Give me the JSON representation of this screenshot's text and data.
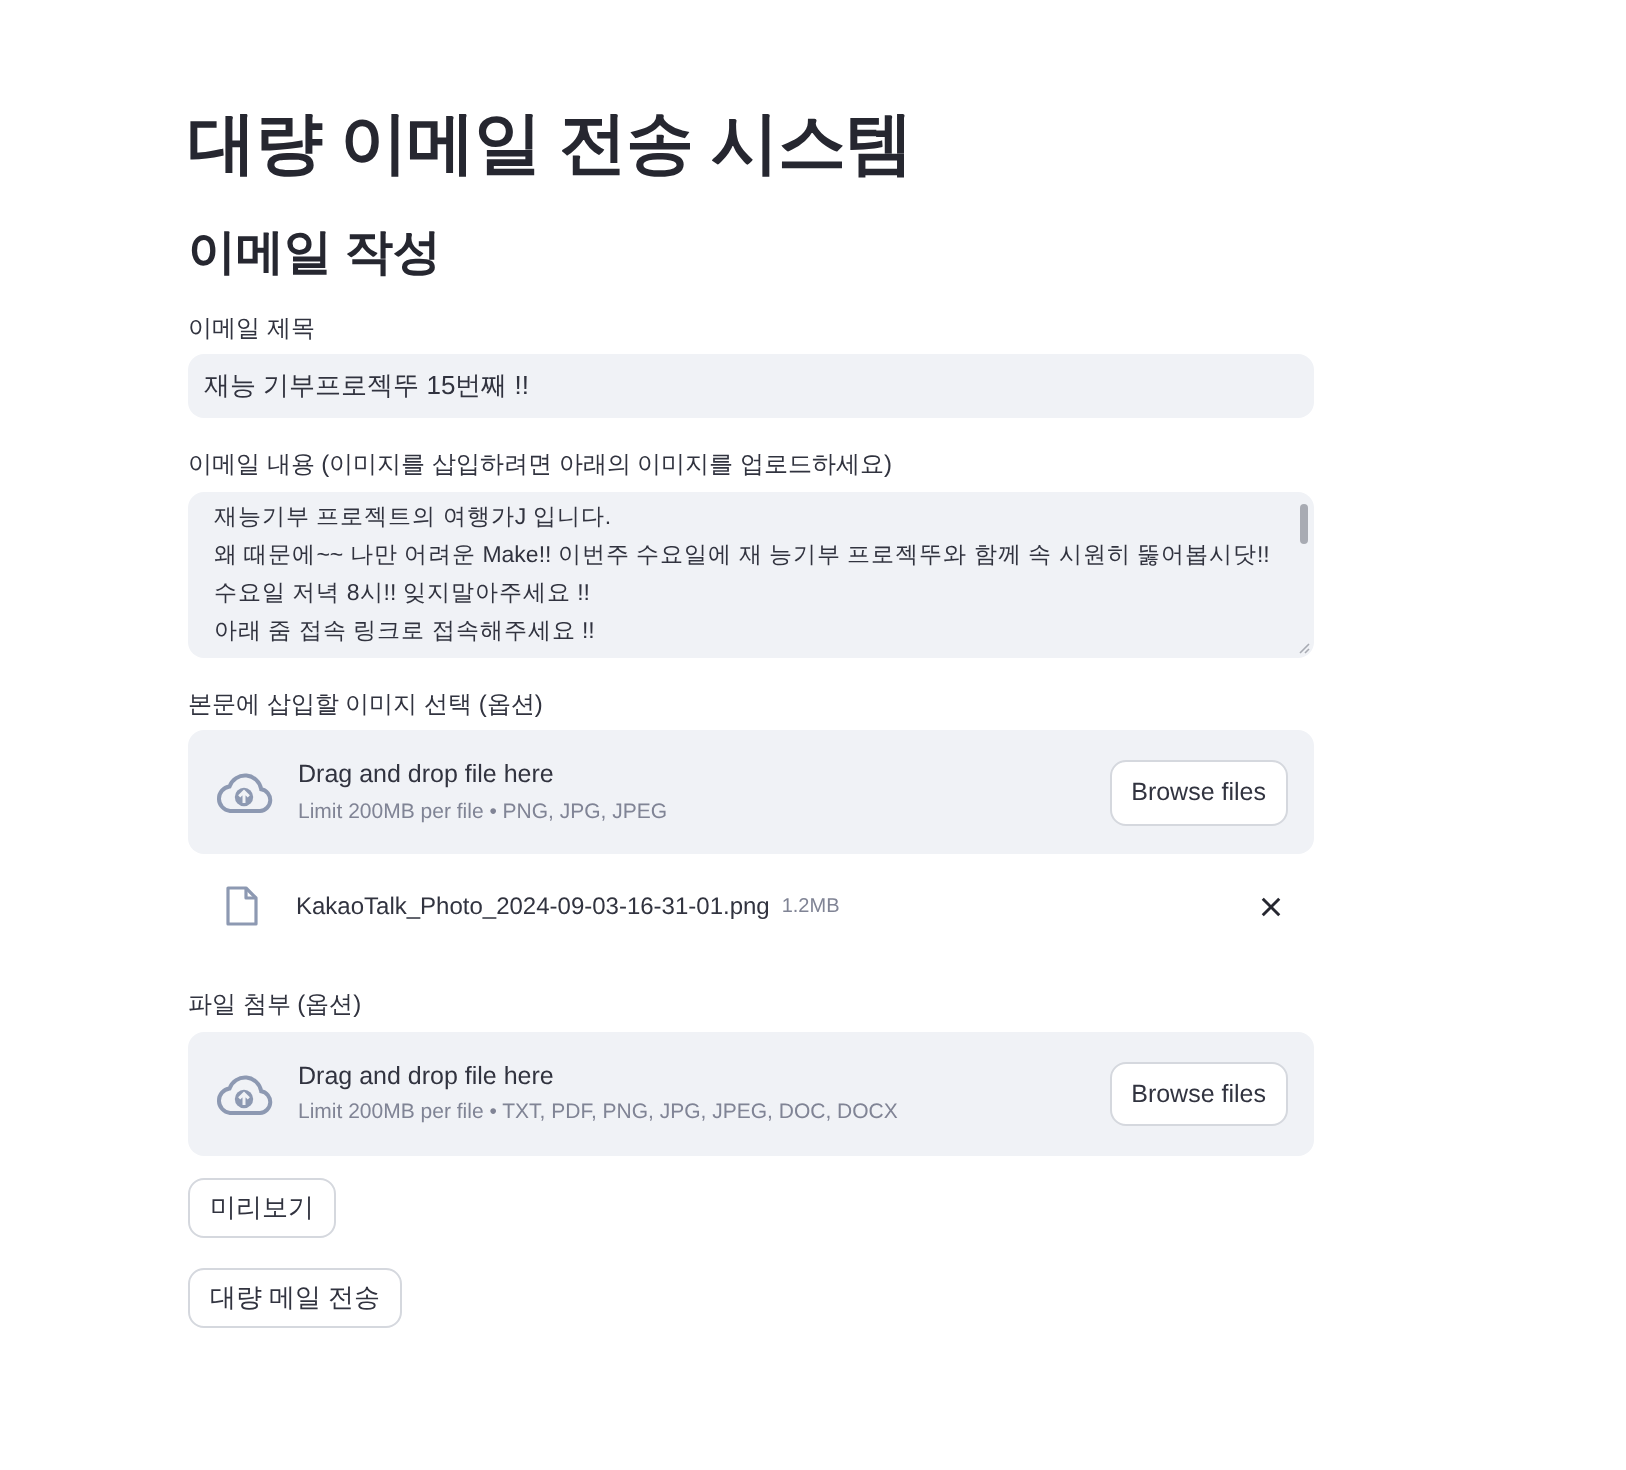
{
  "page": {
    "title": "대량 이메일 전송 시스템",
    "subtitle": "이메일 작성"
  },
  "subject": {
    "label": "이메일 제목",
    "value": "재능 기부프로젝뚜 15번째 !!"
  },
  "body": {
    "label": "이메일 내용 (이미지를 삽입하려면 아래의 이미지를 업로드하세요)",
    "lines": [
      "재능기부 프로젝트의 여행가J 입니다.",
      "왜 때문에~~ 나만 어려운 Make!! 이번주 수요일에 재 능기부 프로젝뚜와 함께 속 시원히 뚫어봅시닷!!",
      "수요일 저녁 8시!! 잊지말아주세요 !!",
      "아래 줌 접속 링크로 접속해주세요 !!"
    ]
  },
  "uploads": [
    {
      "label": "본문에 삽입할 이미지 선택 (옵션)",
      "drop_text": "Drag and drop file here",
      "limit_text": "Limit 200MB per file • PNG, JPG, JPEG",
      "button": "Browse files",
      "files": [
        {
          "name": "KakaoTalk_Photo_2024-09-03-16-31-01.png",
          "size": "1.2MB"
        }
      ]
    },
    {
      "label": "파일 첨부 (옵션)",
      "drop_text": "Drag and drop file here",
      "limit_text": "Limit 200MB per file • TXT, PDF, PNG, JPG, JPEG, DOC, DOCX",
      "button": "Browse files"
    }
  ],
  "buttons": [
    "미리보기",
    "대량 메일 전송"
  ]
}
